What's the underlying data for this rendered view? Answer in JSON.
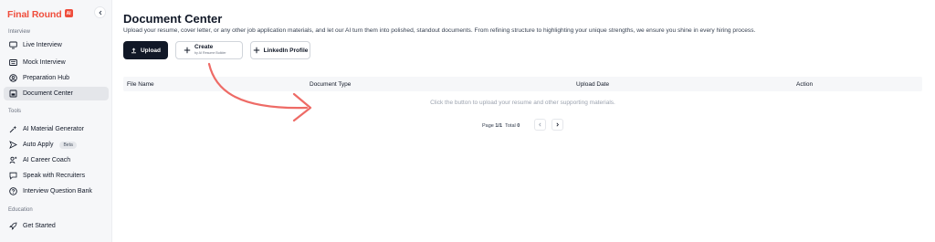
{
  "brand": {
    "name": "Final Round",
    "badge": "AI",
    "accent": "#ef4d3c"
  },
  "sidebar": {
    "sections": [
      {
        "label": "Interview",
        "items": [
          {
            "label": "Live Interview",
            "icon": "monitor-icon"
          },
          {
            "label": "Mock Interview",
            "icon": "keyboard-icon"
          },
          {
            "label": "Preparation Hub",
            "icon": "user-circle-icon"
          },
          {
            "label": "Document Center",
            "icon": "document-icon",
            "active": true
          }
        ]
      },
      {
        "label": "Tools",
        "items": [
          {
            "label": "AI Material Generator",
            "icon": "sparkle-icon"
          },
          {
            "label": "Auto Apply",
            "icon": "send-icon",
            "badge": "Beta"
          },
          {
            "label": "AI Career Coach",
            "icon": "coach-icon"
          },
          {
            "label": "Speak with Recruiters",
            "icon": "chat-icon"
          },
          {
            "label": "Interview Question Bank",
            "icon": "question-icon"
          }
        ]
      },
      {
        "label": "Education",
        "items": [
          {
            "label": "Get Started",
            "icon": "rocket-icon"
          }
        ]
      }
    ]
  },
  "main": {
    "title": "Document Center",
    "description": "Upload your resume, cover letter, or any other job application materials, and let our AI turn them into polished, standout documents. From refining structure to highlighting your unique strengths, we ensure you shine in every hiring process.",
    "buttons": {
      "upload": "Upload",
      "create": "Create",
      "create_sub": "by AI Resume Builder",
      "linkedin": "LinkedIn Profile"
    },
    "table": {
      "columns": [
        "File Name",
        "Document Type",
        "Upload Date",
        "Action"
      ],
      "empty_message": "Click the button to upload your resume and other supporting materials."
    },
    "pagination": {
      "page_label": "Page",
      "page_value": "1/1",
      "total_label": "Total",
      "total_value": "0"
    }
  }
}
